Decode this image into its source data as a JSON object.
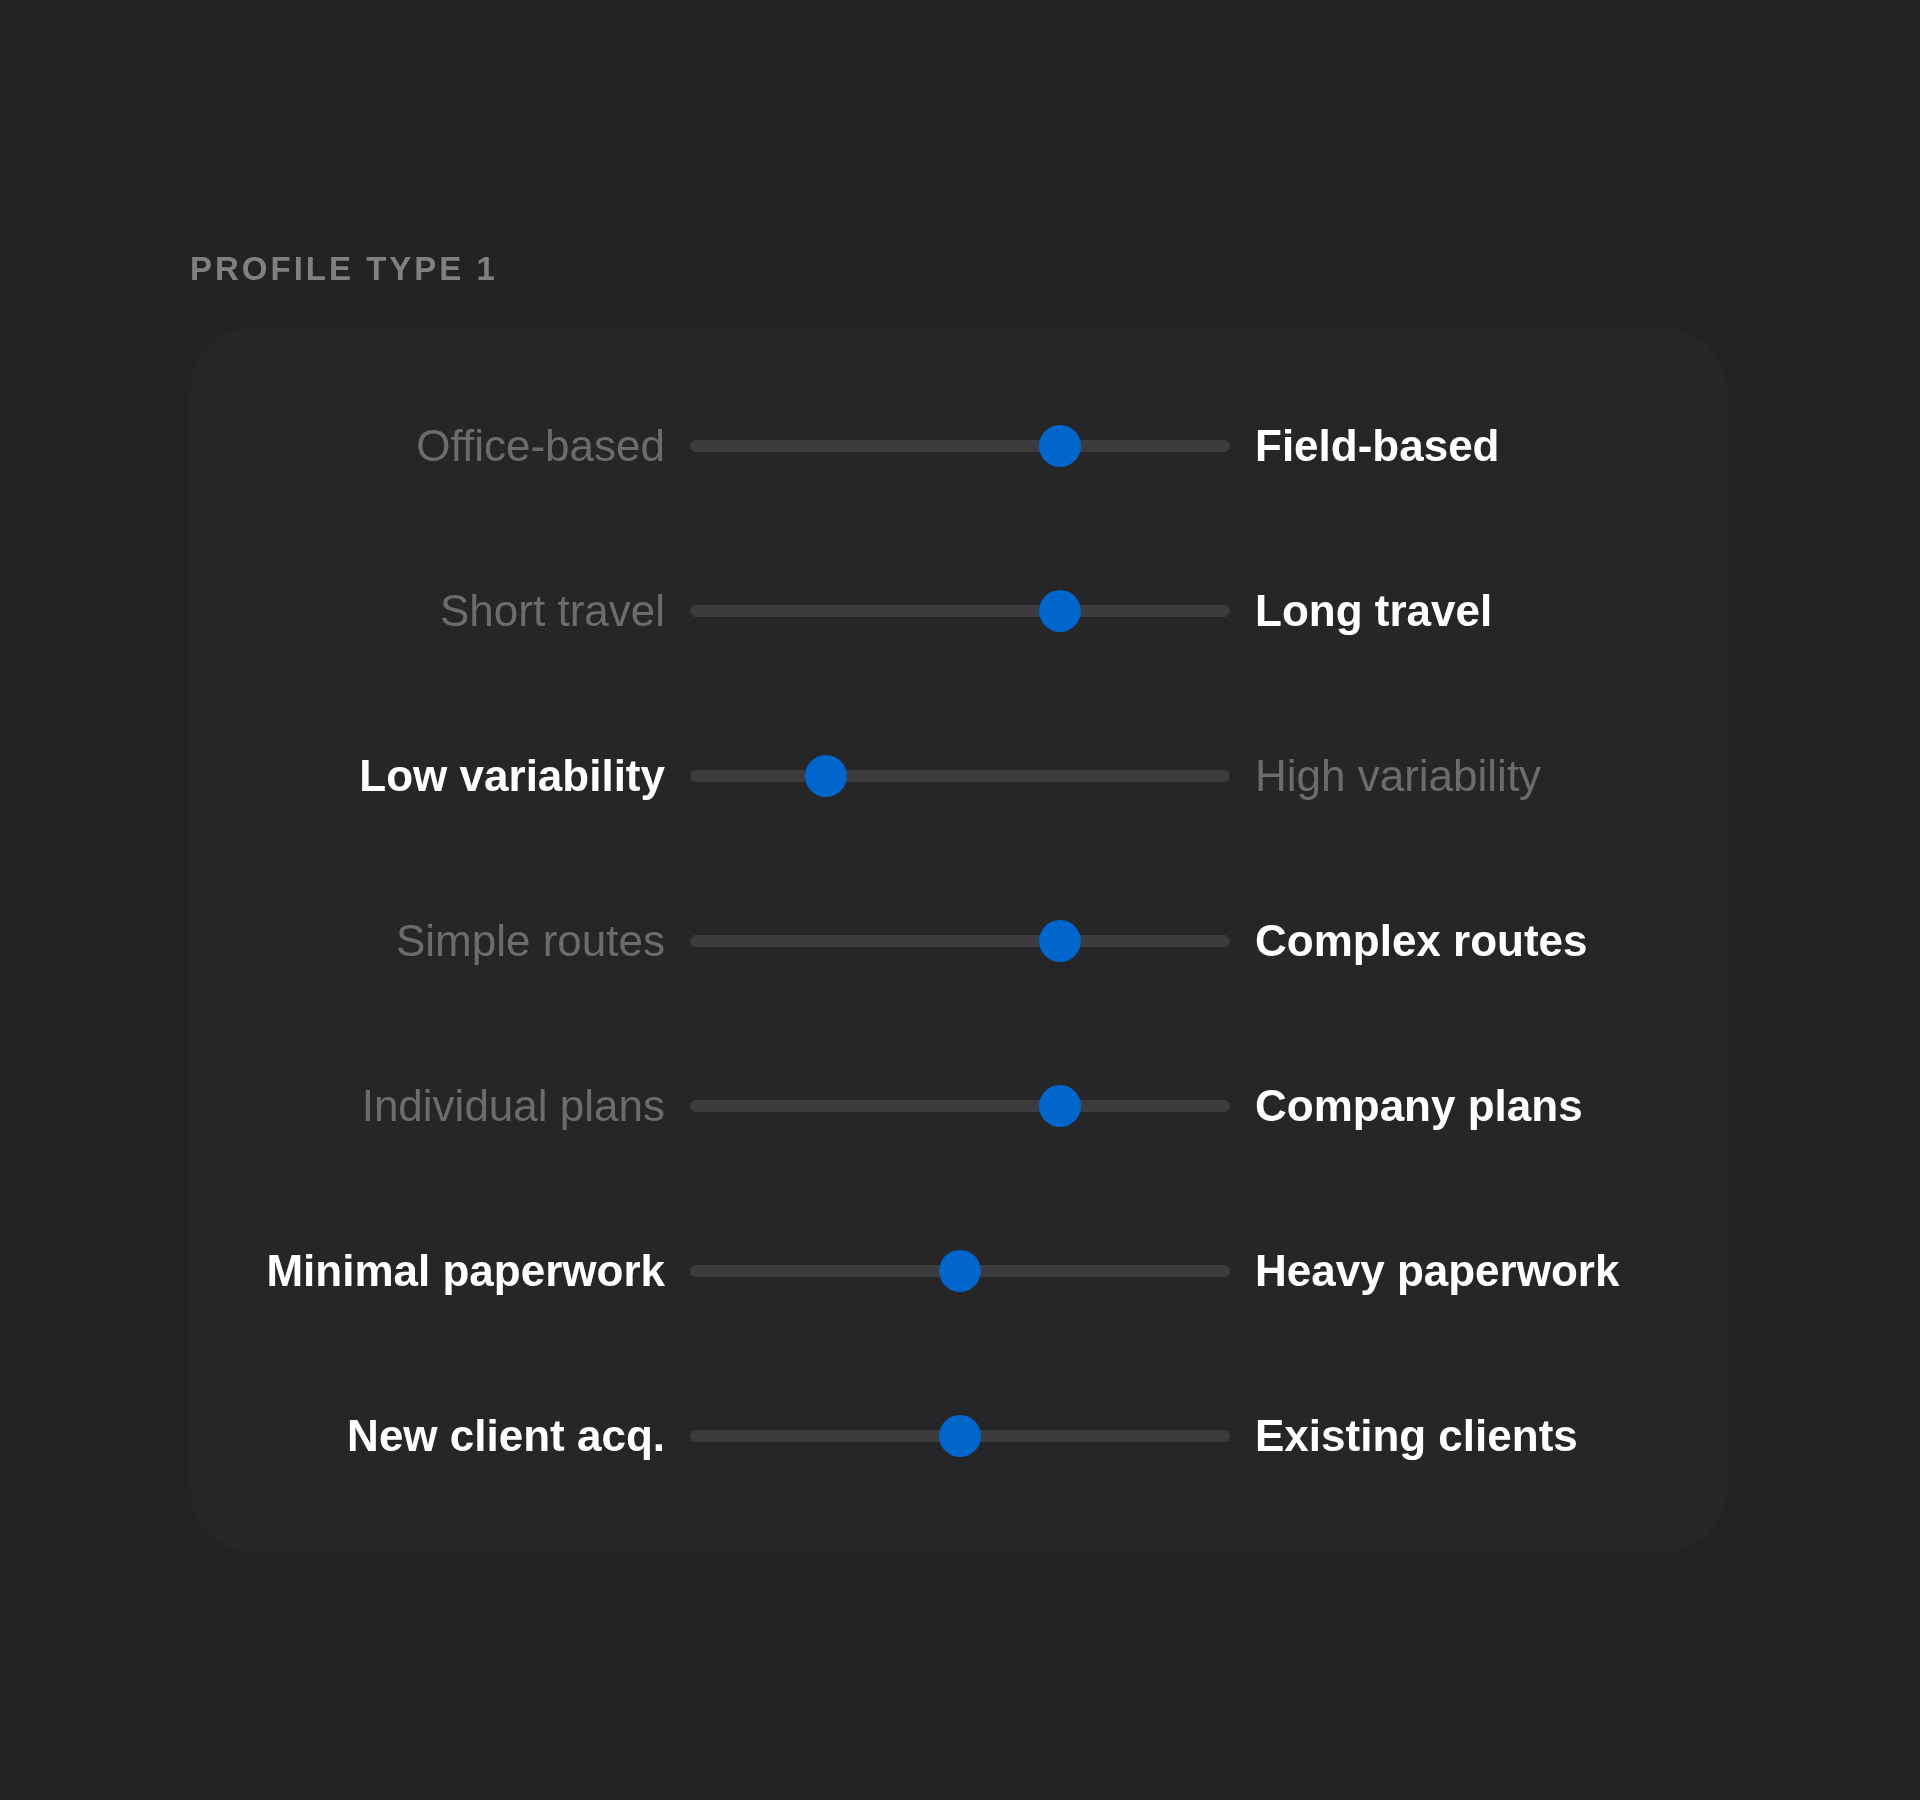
{
  "section": {
    "title": "PROFILE TYPE 1"
  },
  "sliders": [
    {
      "left": {
        "label": "Office-based",
        "emphasized": false
      },
      "right": {
        "label": "Field-based",
        "emphasized": true
      },
      "level": 0.7
    },
    {
      "left": {
        "label": "Short travel",
        "emphasized": false
      },
      "right": {
        "label": "Long travel",
        "emphasized": true
      },
      "level": 0.7
    },
    {
      "left": {
        "label": "Low variability",
        "emphasized": true
      },
      "right": {
        "label": "High variability",
        "emphasized": false
      },
      "level": 0.23
    },
    {
      "left": {
        "label": "Simple routes",
        "emphasized": false
      },
      "right": {
        "label": "Complex routes",
        "emphasized": true
      },
      "level": 0.7
    },
    {
      "left": {
        "label": "Individual plans",
        "emphasized": false
      },
      "right": {
        "label": "Company plans",
        "emphasized": true
      },
      "level": 0.7
    },
    {
      "left": {
        "label": "Minimal paperwork",
        "emphasized": true
      },
      "right": {
        "label": "Heavy paperwork",
        "emphasized": true
      },
      "level": 0.5
    },
    {
      "left": {
        "label": "New client acq.",
        "emphasized": true
      },
      "right": {
        "label": "Existing clients",
        "emphasized": true
      },
      "level": 0.5
    }
  ]
}
